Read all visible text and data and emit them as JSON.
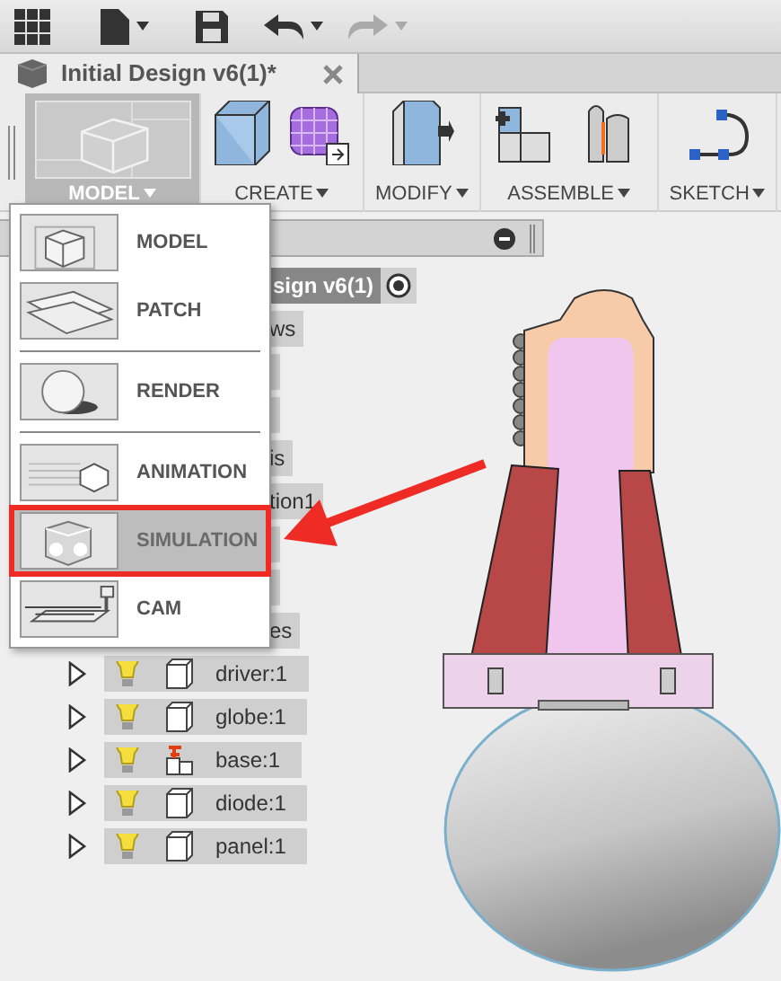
{
  "document_tab": {
    "title": "Initial Design v6(1)*"
  },
  "ribbon": [
    {
      "label": "MODEL",
      "kind": "workspace",
      "selected": true
    },
    {
      "label": "CREATE",
      "kind": "create",
      "selected": false
    },
    {
      "label": "MODIFY",
      "kind": "modify",
      "selected": false
    },
    {
      "label": "ASSEMBLE",
      "kind": "assemble",
      "selected": false
    },
    {
      "label": "SKETCH",
      "kind": "sketch",
      "selected": false
    }
  ],
  "workspace_menu": [
    {
      "label": "MODEL",
      "kind": "model",
      "selected": false,
      "highlighted": false,
      "separator_after": false
    },
    {
      "label": "PATCH",
      "kind": "patch",
      "selected": false,
      "highlighted": false,
      "separator_after": true
    },
    {
      "label": "RENDER",
      "kind": "render",
      "selected": false,
      "highlighted": false,
      "separator_after": true
    },
    {
      "label": "ANIMATION",
      "kind": "animation",
      "selected": false,
      "highlighted": false,
      "separator_after": false
    },
    {
      "label": "SIMULATION",
      "kind": "simulation",
      "selected": true,
      "highlighted": true,
      "separator_after": false
    },
    {
      "label": "CAM",
      "kind": "cam",
      "selected": false,
      "highlighted": false,
      "separator_after": false
    }
  ],
  "browser": {
    "rows": [
      {
        "kind": "root",
        "label": "sign v6(1)"
      },
      {
        "kind": "clipped",
        "label": "ws"
      },
      {
        "kind": "covered"
      },
      {
        "kind": "covered"
      },
      {
        "kind": "clipped",
        "label": "is"
      },
      {
        "kind": "clipped",
        "label": "tion1"
      },
      {
        "kind": "covered"
      },
      {
        "kind": "covered"
      },
      {
        "kind": "clipped",
        "label": "es"
      },
      {
        "kind": "component",
        "label": "driver:1",
        "pinned": false
      },
      {
        "kind": "component",
        "label": "globe:1",
        "pinned": false
      },
      {
        "kind": "component",
        "label": "base:1",
        "pinned": true
      },
      {
        "kind": "component",
        "label": "diode:1",
        "pinned": false
      },
      {
        "kind": "component",
        "label": "panel:1",
        "pinned": false
      }
    ]
  }
}
